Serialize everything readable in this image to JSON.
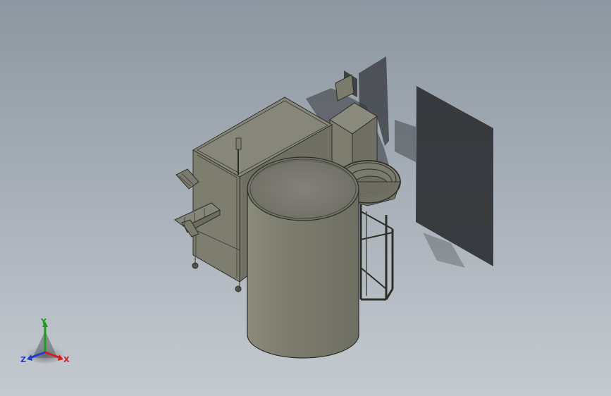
{
  "viewport": {
    "background_top": "#8e97a1",
    "background_bottom": "#c5cad0"
  },
  "model": {
    "body_color": "#7b7b6d",
    "edge_color": "#2e2e28",
    "shadow_color": "#2b2d31"
  },
  "triad": {
    "x_label": "X",
    "y_label": "Y",
    "z_label": "Z",
    "x_color": "#d21e1e",
    "y_color": "#1f9a1f",
    "z_color": "#1e3cd2"
  }
}
